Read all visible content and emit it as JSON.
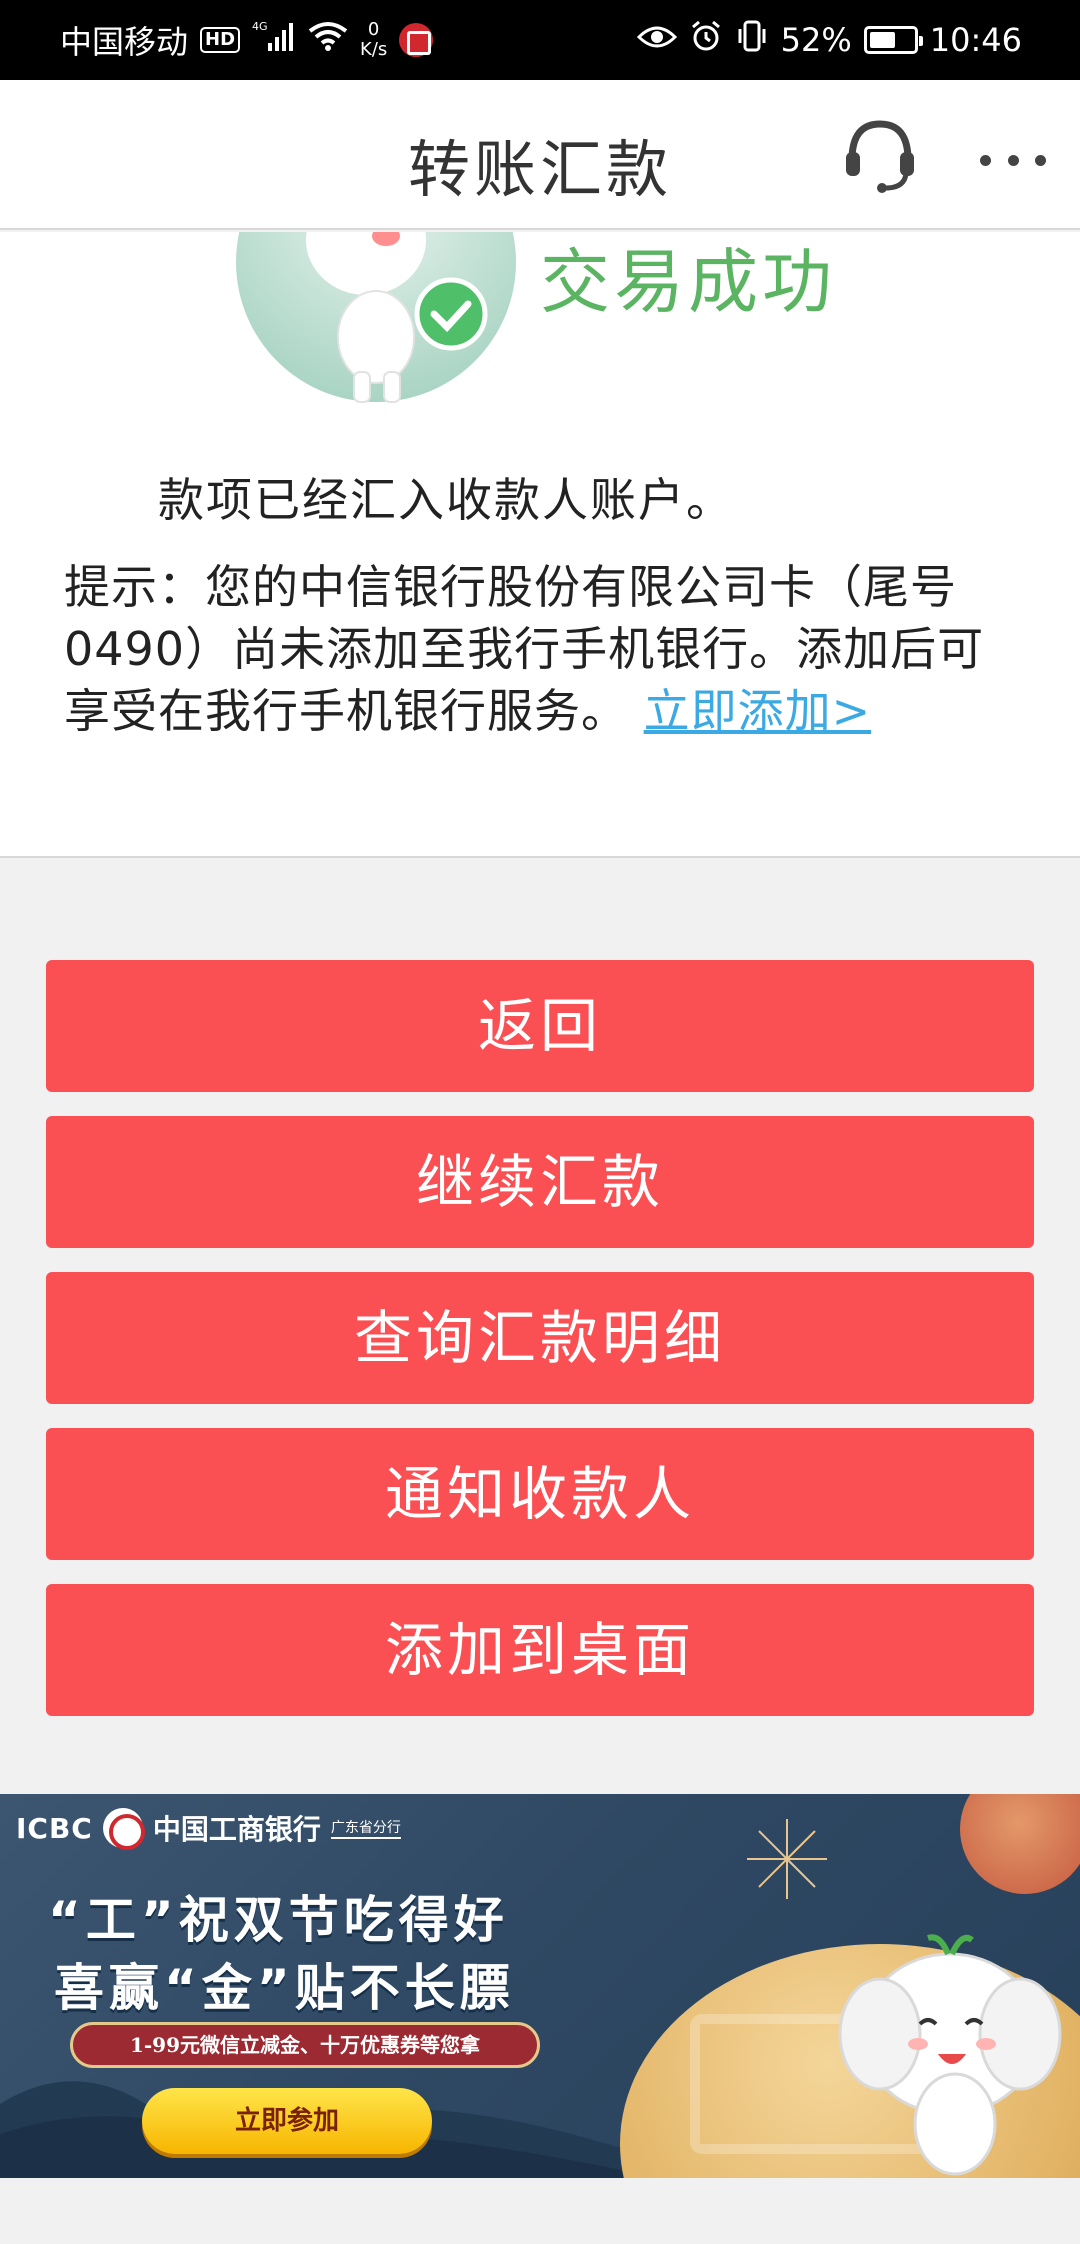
{
  "status_bar": {
    "carrier": "中国移动",
    "hd": "HD",
    "network": "4G",
    "speed_value": "0",
    "speed_unit": "K/s",
    "battery_percent": "52%",
    "battery_level": 0.52,
    "time": "10:46",
    "icons": [
      "signal-icon",
      "wifi-icon",
      "citic-app-icon",
      "eye-icon",
      "alarm-icon",
      "vibrate-icon",
      "battery-icon"
    ]
  },
  "header": {
    "title": "转账汇款",
    "icons": [
      "headset-icon",
      "more-icon"
    ]
  },
  "result": {
    "title": "交易成功",
    "deposit_message": "款项已经汇入收款人账户。",
    "hint_text": "提示：您的中信银行股份有限公司卡（尾号0490）尚未添加至我行手机银行。添加后可享受在我行手机银行服务。",
    "hint_link": "立即添加>",
    "success_color": "#5bb462",
    "link_color": "#3aa9e4"
  },
  "actions": {
    "back": "返回",
    "continue_remit": "继续汇款",
    "query_detail": "查询汇款明细",
    "notify_payee": "通知收款人",
    "add_to_desktop": "添加到桌面",
    "button_color": "#fa4f53"
  },
  "banner": {
    "brand_en": "ICBC",
    "brand_cn": "中国工商银行",
    "branch": "广东省分行",
    "line1": "“工”祝双节吃得好",
    "line2": "喜赢“金”贴不长膘",
    "subline": "1-99元微信立减金、十万优惠券等您拿",
    "cta": "立即参加"
  }
}
